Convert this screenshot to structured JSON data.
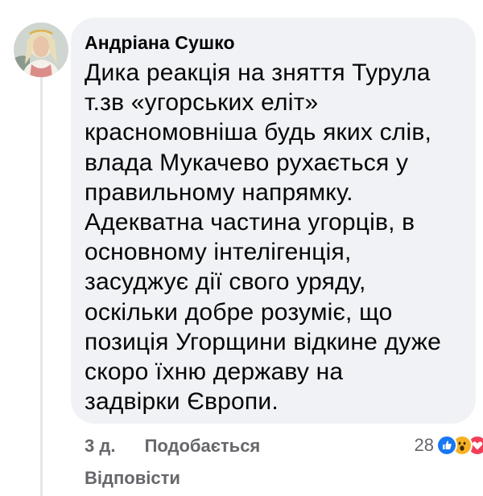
{
  "comment": {
    "author": "Андріана Сушко",
    "lines": [
      "Дика реакція на зняття Турула",
      "т.зв «угорських еліт»",
      "красномовніша будь яких слів,",
      "влада Мукачево рухається у",
      "правильному напрямку.",
      "Адекватна частина угорців, в",
      "основному інтелігенція,",
      "засуджує дії свого уряду,",
      "оскільки добре розуміє, що",
      "позиція Угорщини відкине дуже",
      "скоро їхню державу на",
      "задвірки Європи."
    ]
  },
  "actions": {
    "time": "3 д.",
    "like_label": "Подобається",
    "reply_label": "Відповісти"
  },
  "reactions": {
    "count": "28",
    "icons": [
      "like-icon",
      "wow-icon",
      "love-icon"
    ]
  },
  "colors": {
    "bubble_bg": "#f0f2f5",
    "text": "#050505",
    "secondary_text": "#65676b",
    "like_blue": "#1877f2",
    "wow_yellow": "#f7b125",
    "love_red": "#f33e58"
  }
}
